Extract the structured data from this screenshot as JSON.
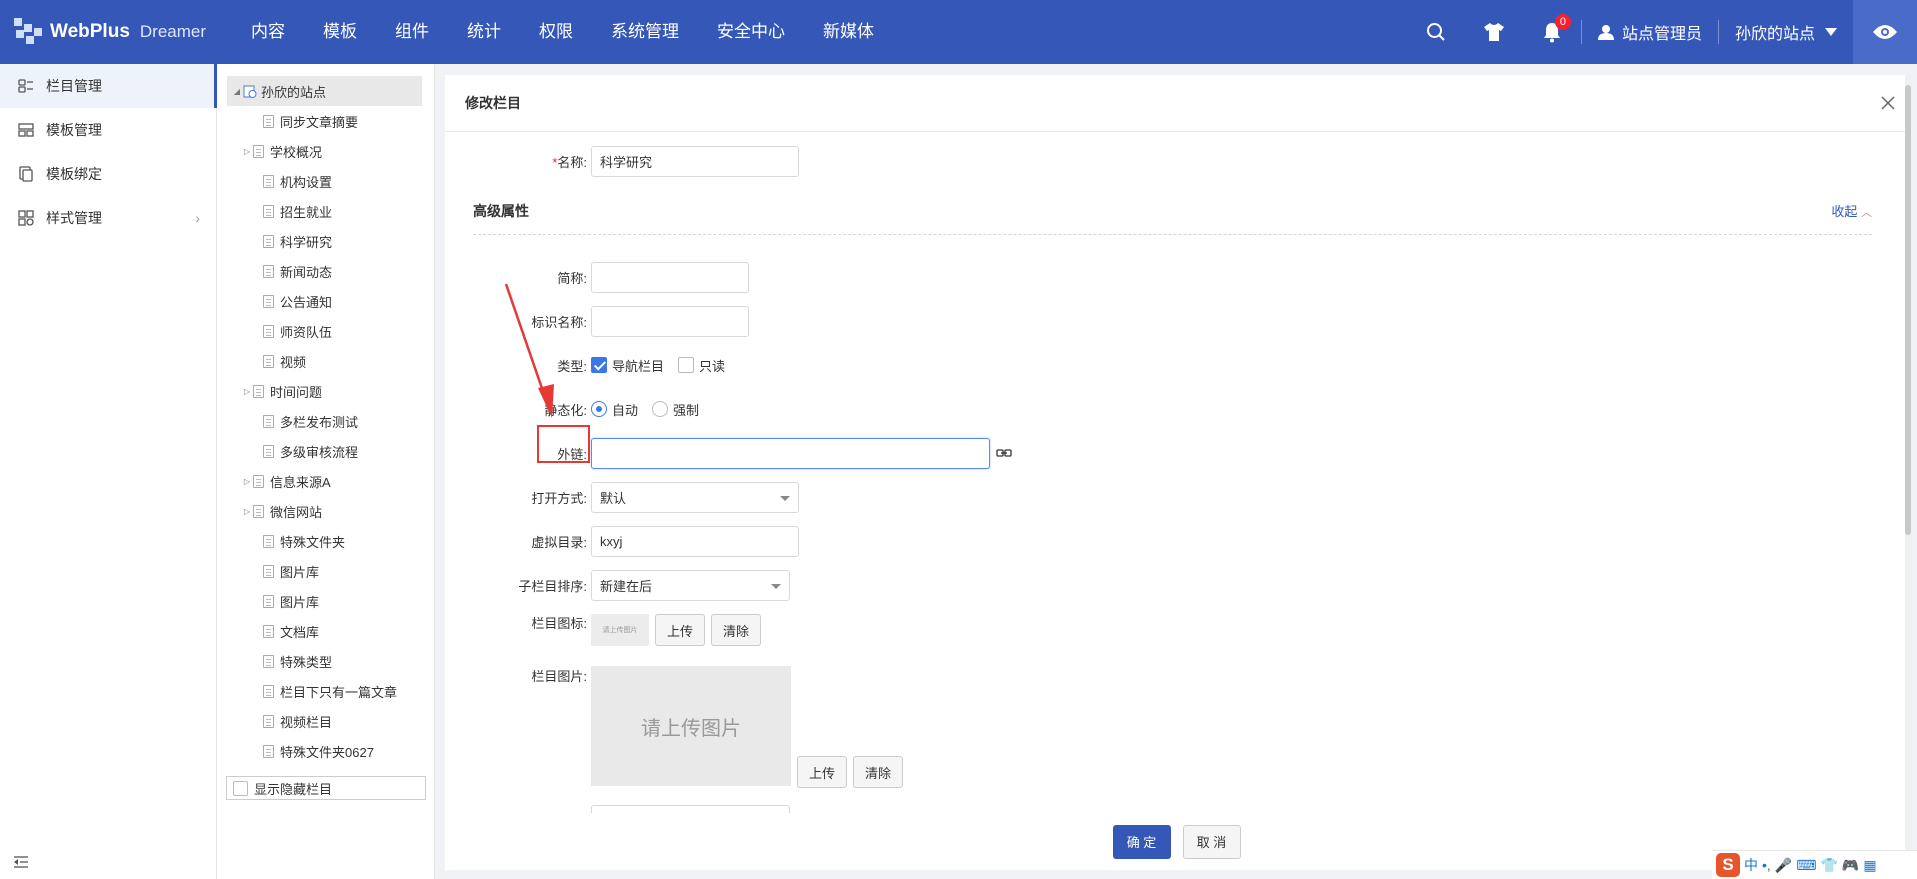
{
  "header": {
    "logo_name": "WebPlus",
    "logo_sub": "Dreamer",
    "nav": [
      "内容",
      "模板",
      "组件",
      "统计",
      "权限",
      "系统管理",
      "安全中心",
      "新媒体"
    ],
    "notification_count": "0",
    "user_name": "站点管理员",
    "site_name": "孙欣的站点",
    "icons": [
      "search-icon",
      "shirt-icon",
      "bell-icon",
      "user-icon",
      "caret-down-icon",
      "eye-icon"
    ],
    "bg_color": "#3558b8"
  },
  "leftmenu": {
    "items": [
      {
        "label": "栏目管理",
        "icon": "column-icon",
        "active": true
      },
      {
        "label": "模板管理",
        "icon": "template-icon"
      },
      {
        "label": "模板绑定",
        "icon": "bind-icon"
      },
      {
        "label": "样式管理",
        "icon": "style-icon",
        "has_children": true
      }
    ]
  },
  "tree": {
    "root": "孙欣的站点",
    "nodes": [
      {
        "label": "同步文章摘要"
      },
      {
        "label": "学校概况",
        "expandable": true
      },
      {
        "label": "机构设置"
      },
      {
        "label": "招生就业"
      },
      {
        "label": "科学研究"
      },
      {
        "label": "新闻动态"
      },
      {
        "label": "公告通知"
      },
      {
        "label": "师资队伍"
      },
      {
        "label": "视频"
      },
      {
        "label": "时间问题",
        "expandable": true
      },
      {
        "label": "多栏发布测试"
      },
      {
        "label": "多级审核流程"
      },
      {
        "label": "信息来源A",
        "expandable": true
      },
      {
        "label": "微信网站",
        "expandable": true
      },
      {
        "label": "特殊文件夹"
      },
      {
        "label": "图片库"
      },
      {
        "label": "图片库"
      },
      {
        "label": "文档库"
      },
      {
        "label": "特殊类型"
      },
      {
        "label": "栏目下只有一篇文章"
      },
      {
        "label": "视频栏目"
      },
      {
        "label": "特殊文件夹0627"
      }
    ],
    "show_hidden": "显示隐藏栏目"
  },
  "panel": {
    "title": "修改栏目",
    "name_label": "名称:",
    "name_value": "科学研究",
    "advanced_title": "高级属性",
    "collapse_label": "收起",
    "short_label": "简称:",
    "ident_label": "标识名称:",
    "type_label": "类型:",
    "type_nav": "导航栏目",
    "type_readonly": "只读",
    "static_label": "静态化:",
    "static_auto": "自动",
    "static_force": "强制",
    "link_label": "外链:",
    "open_label": "打开方式:",
    "open_value": "默认",
    "vdir_label": "虚拟目录:",
    "vdir_value": "kxyj",
    "sort_label": "子栏目排序:",
    "sort_value": "新建在后",
    "icon_label": "栏目图标:",
    "icon_thumb": "请上传图片",
    "upload_label": "上传",
    "clear_label": "清除",
    "image_label": "栏目图片:",
    "image_placeholder": "请上传图片",
    "confirm_label": "确 定",
    "cancel_label": "取 消"
  },
  "ime": {
    "logo": "S",
    "mode": "中"
  }
}
